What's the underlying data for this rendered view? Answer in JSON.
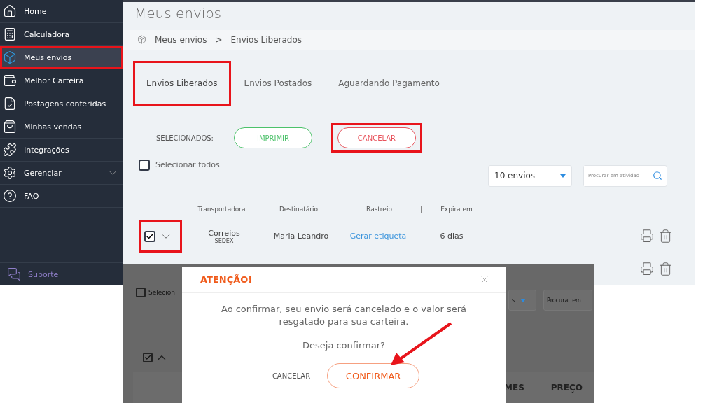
{
  "sidebar": {
    "items": [
      {
        "label": "Home",
        "selected": false,
        "highlighted": false
      },
      {
        "label": "Calculadora",
        "selected": false,
        "highlighted": false
      },
      {
        "label": "Meus envios",
        "selected": true,
        "highlighted": true
      },
      {
        "label": "Melhor Carteira",
        "selected": false,
        "highlighted": false
      },
      {
        "label": "Postagens conferidas",
        "selected": false,
        "highlighted": false
      },
      {
        "label": "Minhas vendas",
        "selected": false,
        "highlighted": false
      },
      {
        "label": "Integrações",
        "selected": false,
        "highlighted": false
      },
      {
        "label": "Gerenciar",
        "selected": false,
        "highlighted": false,
        "expandable": true
      },
      {
        "label": "FAQ",
        "selected": false,
        "highlighted": false
      }
    ],
    "support": "Suporte"
  },
  "page": {
    "title": "Meus envios",
    "breadcrumb": [
      "Meus envios",
      "Envios Liberados"
    ],
    "breadcrumb_separator": ">",
    "tabs": [
      {
        "label": "Envios Liberados",
        "selected": true,
        "highlighted": true
      },
      {
        "label": "Envios Postados",
        "selected": false,
        "highlighted": false
      },
      {
        "label": "Aguardando Pagamento",
        "selected": false,
        "highlighted": false
      }
    ],
    "selection": {
      "label": "SELECIONADOS:",
      "buttons": [
        {
          "label": "IMPRIMIR",
          "kind": "print",
          "highlighted": false
        },
        {
          "label": "CANCELAR",
          "kind": "cancel",
          "highlighted": true
        }
      ]
    },
    "select_all": {
      "label": "Selecionar todos",
      "checked": false
    },
    "page_size": "10 envios",
    "search": {
      "placeholder": "Procurar em atividad"
    },
    "columns": [
      "Transportadora",
      "Destinatário",
      "Rastreio",
      "Expira em"
    ],
    "rows": [
      {
        "kind": "full",
        "checked": true,
        "highlighted": true,
        "expanded": false,
        "carrier": "Correios",
        "service": "SEDEX",
        "recipient": "Maria Leandro",
        "tracking": "Gerar etiqueta",
        "expires": "6 dias"
      },
      {
        "kind": "partial"
      }
    ]
  },
  "inset": {
    "select_all": {
      "label": "Selecion",
      "checked": false
    },
    "page_size": "s",
    "search": {
      "placeholder": "Procurar em"
    },
    "row": {
      "checked": true,
      "expanded": true
    },
    "columns": [
      "MES",
      "PREÇO"
    ]
  },
  "dialog": {
    "title": "ATENÇÃO!",
    "message": "Ao confirmar, seu envio será cancelado e o valor será resgatado para sua carteira.",
    "question": "Deseja confirmar?",
    "buttons": [
      {
        "label": "CANCELAR",
        "kind": "plain"
      },
      {
        "label": "CONFIRMAR",
        "kind": "primary"
      }
    ]
  }
}
